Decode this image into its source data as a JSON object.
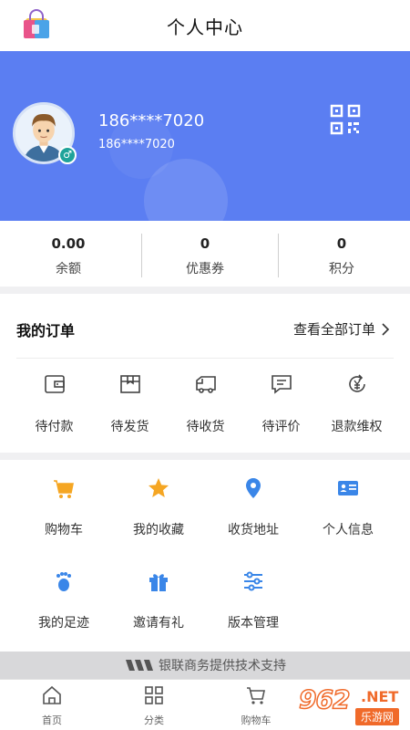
{
  "header": {
    "title": "个人中心"
  },
  "profile": {
    "phone": "186****7020",
    "phone_sub": "186****7020",
    "gender_symbol": "♂"
  },
  "stats": [
    {
      "value": "0.00",
      "label": "余额"
    },
    {
      "value": "0",
      "label": "优惠券"
    },
    {
      "value": "0",
      "label": "积分"
    }
  ],
  "orders": {
    "title": "我的订单",
    "view_all": "查看全部订单",
    "items": [
      {
        "label": "待付款",
        "icon": "wallet-icon"
      },
      {
        "label": "待发货",
        "icon": "box-icon"
      },
      {
        "label": "待收货",
        "icon": "truck-icon"
      },
      {
        "label": "待评价",
        "icon": "comment-icon"
      },
      {
        "label": "退款维权",
        "icon": "refund-icon"
      }
    ]
  },
  "tools": [
    {
      "label": "购物车",
      "icon": "cart-icon"
    },
    {
      "label": "我的收藏",
      "icon": "star-icon"
    },
    {
      "label": "收货地址",
      "icon": "location-icon"
    },
    {
      "label": "个人信息",
      "icon": "id-card-icon"
    },
    {
      "label": "我的足迹",
      "icon": "footprint-icon"
    },
    {
      "label": "邀请有礼",
      "icon": "gift-icon"
    },
    {
      "label": "版本管理",
      "icon": "sliders-icon"
    }
  ],
  "footer": {
    "support_text": "银联商务提供技术支持"
  },
  "tabbar": [
    {
      "label": "首页",
      "icon": "home-icon"
    },
    {
      "label": "分类",
      "icon": "grid-icon"
    },
    {
      "label": "购物车",
      "icon": "cart-icon"
    }
  ],
  "watermark": {
    "number": "962",
    "net": ".NET",
    "site": "乐游网"
  },
  "colors": {
    "banner": "#5b7ef2",
    "accent": "#f5a623",
    "blue": "#3a86e8",
    "teal": "#1fa39a",
    "orange": "#f06a2a"
  }
}
